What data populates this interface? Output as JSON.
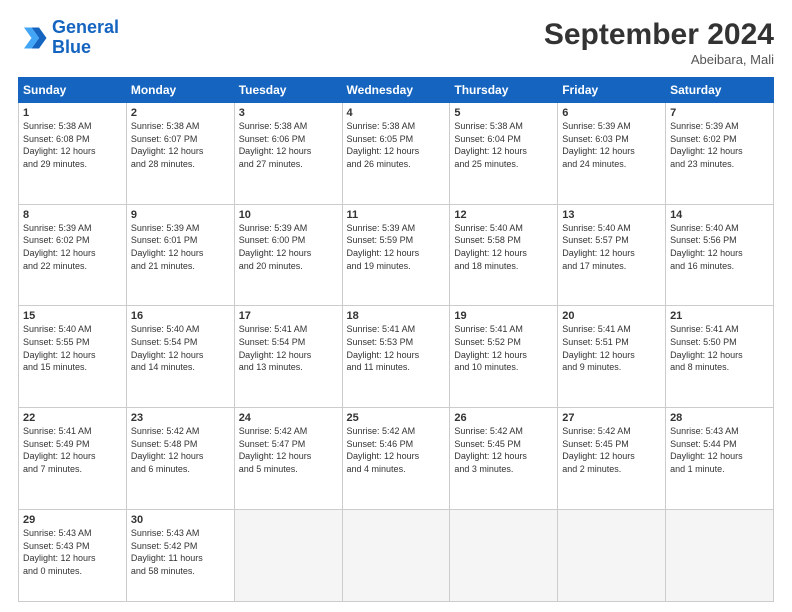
{
  "logo": {
    "line1": "General",
    "line2": "Blue"
  },
  "title": "September 2024",
  "location": "Abeibara, Mali",
  "days_header": [
    "Sunday",
    "Monday",
    "Tuesday",
    "Wednesday",
    "Thursday",
    "Friday",
    "Saturday"
  ],
  "weeks": [
    [
      {
        "day": "1",
        "info": "Sunrise: 5:38 AM\nSunset: 6:08 PM\nDaylight: 12 hours\nand 29 minutes."
      },
      {
        "day": "2",
        "info": "Sunrise: 5:38 AM\nSunset: 6:07 PM\nDaylight: 12 hours\nand 28 minutes."
      },
      {
        "day": "3",
        "info": "Sunrise: 5:38 AM\nSunset: 6:06 PM\nDaylight: 12 hours\nand 27 minutes."
      },
      {
        "day": "4",
        "info": "Sunrise: 5:38 AM\nSunset: 6:05 PM\nDaylight: 12 hours\nand 26 minutes."
      },
      {
        "day": "5",
        "info": "Sunrise: 5:38 AM\nSunset: 6:04 PM\nDaylight: 12 hours\nand 25 minutes."
      },
      {
        "day": "6",
        "info": "Sunrise: 5:39 AM\nSunset: 6:03 PM\nDaylight: 12 hours\nand 24 minutes."
      },
      {
        "day": "7",
        "info": "Sunrise: 5:39 AM\nSunset: 6:02 PM\nDaylight: 12 hours\nand 23 minutes."
      }
    ],
    [
      {
        "day": "8",
        "info": "Sunrise: 5:39 AM\nSunset: 6:02 PM\nDaylight: 12 hours\nand 22 minutes."
      },
      {
        "day": "9",
        "info": "Sunrise: 5:39 AM\nSunset: 6:01 PM\nDaylight: 12 hours\nand 21 minutes."
      },
      {
        "day": "10",
        "info": "Sunrise: 5:39 AM\nSunset: 6:00 PM\nDaylight: 12 hours\nand 20 minutes."
      },
      {
        "day": "11",
        "info": "Sunrise: 5:39 AM\nSunset: 5:59 PM\nDaylight: 12 hours\nand 19 minutes."
      },
      {
        "day": "12",
        "info": "Sunrise: 5:40 AM\nSunset: 5:58 PM\nDaylight: 12 hours\nand 18 minutes."
      },
      {
        "day": "13",
        "info": "Sunrise: 5:40 AM\nSunset: 5:57 PM\nDaylight: 12 hours\nand 17 minutes."
      },
      {
        "day": "14",
        "info": "Sunrise: 5:40 AM\nSunset: 5:56 PM\nDaylight: 12 hours\nand 16 minutes."
      }
    ],
    [
      {
        "day": "15",
        "info": "Sunrise: 5:40 AM\nSunset: 5:55 PM\nDaylight: 12 hours\nand 15 minutes."
      },
      {
        "day": "16",
        "info": "Sunrise: 5:40 AM\nSunset: 5:54 PM\nDaylight: 12 hours\nand 14 minutes."
      },
      {
        "day": "17",
        "info": "Sunrise: 5:41 AM\nSunset: 5:54 PM\nDaylight: 12 hours\nand 13 minutes."
      },
      {
        "day": "18",
        "info": "Sunrise: 5:41 AM\nSunset: 5:53 PM\nDaylight: 12 hours\nand 11 minutes."
      },
      {
        "day": "19",
        "info": "Sunrise: 5:41 AM\nSunset: 5:52 PM\nDaylight: 12 hours\nand 10 minutes."
      },
      {
        "day": "20",
        "info": "Sunrise: 5:41 AM\nSunset: 5:51 PM\nDaylight: 12 hours\nand 9 minutes."
      },
      {
        "day": "21",
        "info": "Sunrise: 5:41 AM\nSunset: 5:50 PM\nDaylight: 12 hours\nand 8 minutes."
      }
    ],
    [
      {
        "day": "22",
        "info": "Sunrise: 5:41 AM\nSunset: 5:49 PM\nDaylight: 12 hours\nand 7 minutes."
      },
      {
        "day": "23",
        "info": "Sunrise: 5:42 AM\nSunset: 5:48 PM\nDaylight: 12 hours\nand 6 minutes."
      },
      {
        "day": "24",
        "info": "Sunrise: 5:42 AM\nSunset: 5:47 PM\nDaylight: 12 hours\nand 5 minutes."
      },
      {
        "day": "25",
        "info": "Sunrise: 5:42 AM\nSunset: 5:46 PM\nDaylight: 12 hours\nand 4 minutes."
      },
      {
        "day": "26",
        "info": "Sunrise: 5:42 AM\nSunset: 5:45 PM\nDaylight: 12 hours\nand 3 minutes."
      },
      {
        "day": "27",
        "info": "Sunrise: 5:42 AM\nSunset: 5:45 PM\nDaylight: 12 hours\nand 2 minutes."
      },
      {
        "day": "28",
        "info": "Sunrise: 5:43 AM\nSunset: 5:44 PM\nDaylight: 12 hours\nand 1 minute."
      }
    ],
    [
      {
        "day": "29",
        "info": "Sunrise: 5:43 AM\nSunset: 5:43 PM\nDaylight: 12 hours\nand 0 minutes."
      },
      {
        "day": "30",
        "info": "Sunrise: 5:43 AM\nSunset: 5:42 PM\nDaylight: 11 hours\nand 58 minutes."
      },
      {
        "day": "",
        "info": ""
      },
      {
        "day": "",
        "info": ""
      },
      {
        "day": "",
        "info": ""
      },
      {
        "day": "",
        "info": ""
      },
      {
        "day": "",
        "info": ""
      }
    ]
  ]
}
